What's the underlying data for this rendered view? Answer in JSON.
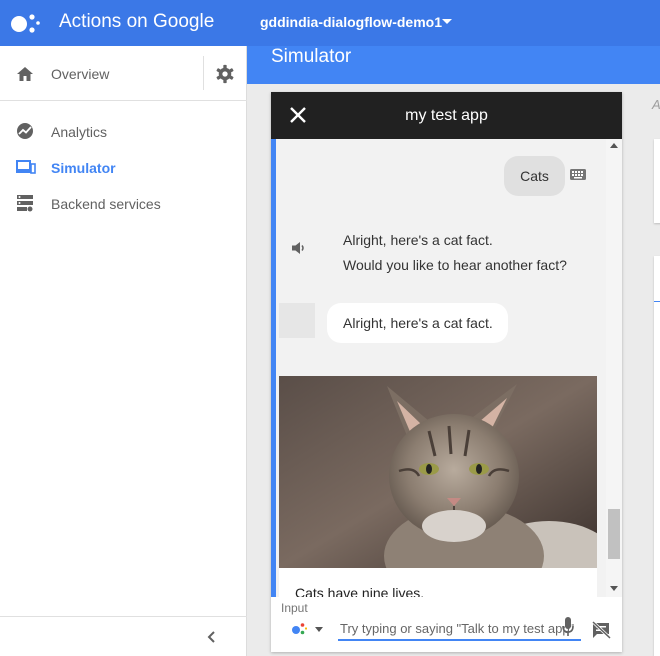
{
  "app": {
    "brand": "Actions on Google",
    "project": "gddindia-dialogflow-demo1",
    "page_title": "Simulator"
  },
  "colors": {
    "topbar": "#3b78e7",
    "page_band": "#4285f4",
    "accent": "#4285f4",
    "sim_header": "#212121",
    "active_nav": "#4285f4"
  },
  "sidebar": {
    "overview": {
      "label": "Overview",
      "icon": "home-icon"
    },
    "settings_icon": "gear-icon",
    "items": [
      {
        "label": "Analytics",
        "icon": "trending-icon",
        "active": false
      },
      {
        "label": "Simulator",
        "icon": "devices-icon",
        "active": true
      },
      {
        "label": "Backend services",
        "icon": "storage-icon",
        "active": false
      }
    ],
    "collapse_icon": "chevron-left-icon"
  },
  "simulator": {
    "title": "my test app",
    "close_icon": "close-icon",
    "conversation": {
      "user_message": "Cats",
      "speech_lines": [
        "Alright, here's a cat fact.",
        "Would you like to hear another fact?"
      ],
      "bot_bubble": "Alright, here's a cat fact.",
      "card_text": "Cats have nine lives."
    },
    "input": {
      "label": "Input",
      "placeholder": "Try typing or saying \"Talk to my test app\""
    }
  },
  "right_panel": {
    "partial_label": "A"
  }
}
